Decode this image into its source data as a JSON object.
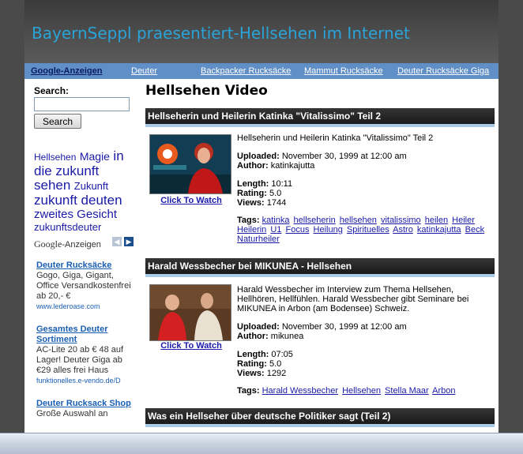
{
  "header": {
    "title": "BayernSeppl praesentiert-Hellsehen im Internet"
  },
  "linkbar": {
    "ads_label": "Google-Anzeigen",
    "links": [
      "Deuter",
      "Backpacker Rucksäcke",
      "Mammut Rucksäcke",
      "Deuter Rucksäcke Giga"
    ]
  },
  "sidebar": {
    "search_label": "Search:",
    "search_value": "",
    "search_button": "Search",
    "tags": [
      {
        "text": "Hellsehen"
      },
      {
        "text": "Magie"
      },
      {
        "text": "in die zukunft sehen"
      },
      {
        "text": "Zukunft"
      },
      {
        "text": "zukunft deuten"
      },
      {
        "text": "zweites Gesicht"
      },
      {
        "text": "zukunftsdeuter"
      }
    ],
    "ads_brand": "Google",
    "ads_suffix": "-Anzeigen",
    "ads": [
      {
        "title": "Deuter Rucksäcke",
        "desc": "Gogo, Giga, Gigant, Office Versandkostenfrei ab 20,- €",
        "url": "www.lederoase.com"
      },
      {
        "title": "Gesamtes Deuter Sortiment",
        "desc": "AC-Lite 20 ab € 48 auf Lager! Deuter Giga ab €29 alles frei Haus",
        "url": "funktionelles.e-vendo.de/D"
      },
      {
        "title": "Deuter Rucksack Shop",
        "desc": "Große Auswahl an",
        "url": ""
      }
    ]
  },
  "main": {
    "heading": "Hellsehen Video",
    "videos": [
      {
        "title": "Hellseherin und Heilerin Katinka \"Vitalissimo\" Teil 2",
        "watch": "Click To Watch",
        "desc": "Hellseherin und Heilerin Katinka \"Vitalissimo\" Teil 2",
        "uploaded_label": "Uploaded:",
        "uploaded": "November 30, 1999 at 12:00 am",
        "author_label": "Author:",
        "author": "katinkajutta",
        "length_label": "Length:",
        "length": "10:11",
        "rating_label": "Rating:",
        "rating": "5.0",
        "views_label": "Views:",
        "views": "1744",
        "tags_label": "Tags:",
        "tags": [
          "katinka",
          "hellseherin",
          "hellsehen",
          "vitalissimo",
          "heilen",
          "Heiler",
          "Heilerin",
          "U1",
          "Focus",
          "Heilung",
          "Spirituelles",
          "Astro",
          "katinkajutta",
          "Beck",
          "Naturheiler"
        ]
      },
      {
        "title": "Harald Wessbecher bei MIKUNEA - Hellsehen",
        "watch": "Click To Watch",
        "desc": "Harald Wessbecher im Interview zum Thema Hellsehen, Hellhören, Hellfühlen. Harald Wessbecher gibt Seminare bei MIKUNEA in Arbon (am Bodensee) Schweiz.",
        "uploaded_label": "Uploaded:",
        "uploaded": "November 30, 1999 at 12:00 am",
        "author_label": "Author:",
        "author": "mikunea",
        "length_label": "Length:",
        "length": "07:05",
        "rating_label": "Rating:",
        "rating": "5.0",
        "views_label": "Views:",
        "views": "1292",
        "tags_label": "Tags:",
        "tags": [
          "Harald Wessbecher",
          "Hellsehen",
          "Stella Maar",
          "Arbon"
        ]
      },
      {
        "title": "Was ein Hellseher über deutsche Politiker sagt (Teil 2)"
      }
    ]
  },
  "colors": {
    "title": "#2aa3d8",
    "linkbar": "#5f8fc6",
    "video_header": "#1a1a1a",
    "link": "#1a1aa8"
  }
}
